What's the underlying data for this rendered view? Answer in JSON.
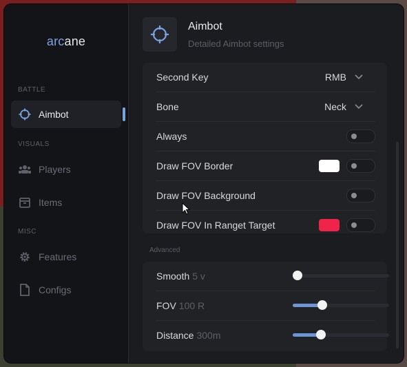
{
  "app": {
    "logo_prefix": "arc",
    "logo_suffix": "ane"
  },
  "sidebar": {
    "sections": {
      "battle": "BATTLE",
      "visuals": "VISUALS",
      "misc": "MISC"
    },
    "items": [
      {
        "label": "Aimbot",
        "icon": "crosshair-icon",
        "active": true
      },
      {
        "label": "Players",
        "icon": "users-icon"
      },
      {
        "label": "Items",
        "icon": "box-icon"
      },
      {
        "label": "Features",
        "icon": "gear-icon"
      },
      {
        "label": "Configs",
        "icon": "file-icon"
      }
    ]
  },
  "header": {
    "title": "Aimbot",
    "subtitle": "Detailed Aimbot settings"
  },
  "settings": {
    "second_key": {
      "label": "Second Key",
      "value": "RMB"
    },
    "bone": {
      "label": "Bone",
      "value": "Neck"
    },
    "always": {
      "label": "Always",
      "enabled": false
    },
    "draw_fov_border": {
      "label": "Draw FOV Border",
      "color": "#ffffff",
      "enabled": false
    },
    "draw_fov_background": {
      "label": "Draw FOV Background",
      "enabled": false
    },
    "draw_fov_in_range": {
      "label": "Draw FOV In Ranget Target",
      "color": "#f0234b",
      "enabled": false
    }
  },
  "advanced": {
    "label": "Advanced",
    "smooth": {
      "label": "Smooth",
      "value_text": "5 v",
      "fraction": 0.05
    },
    "fov": {
      "label": "FOV",
      "value_text": "100 R",
      "fraction": 0.31
    },
    "distance": {
      "label": "Distance",
      "value_text": "300m",
      "fraction": 0.29
    }
  },
  "colors": {
    "accent": "#7aa2e0",
    "slider_fill": "#6d95d6"
  }
}
